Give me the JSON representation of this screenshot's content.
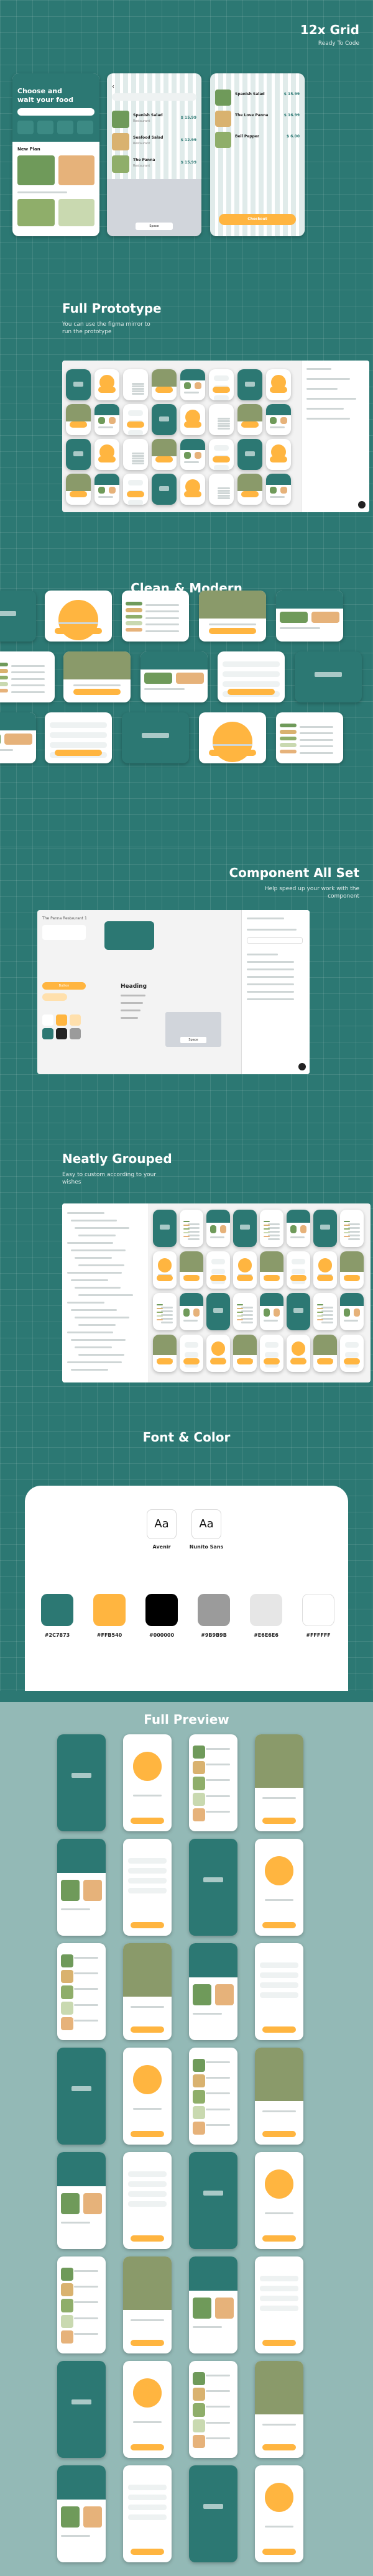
{
  "hero": {
    "title": "12x Grid",
    "subtitle": "Ready To Code",
    "app_heading_line1": "Choose and",
    "app_heading_line2": "wait your food",
    "new_plan_label": "New Plan",
    "menu_items": [
      {
        "name": "Spanish Salad",
        "sub": "Restaurant",
        "price": "$ 15.99"
      },
      {
        "name": "Seafood Salad",
        "sub": "Restaurant",
        "price": "$ 12.99"
      },
      {
        "name": "The Panna",
        "sub": "Restaurant",
        "price": "$ 15.99"
      }
    ],
    "cart_items": [
      {
        "name": "Spanish Salad",
        "price": "$ 15.99"
      },
      {
        "name": "The Love Panna",
        "price": "$ 16.99"
      },
      {
        "name": "Bell Pepper",
        "price": "$ 6.00"
      }
    ],
    "keyboard_space_label": "Space",
    "checkout_label": "Checkout"
  },
  "prototype": {
    "title": "Full Prototype",
    "subtitle_line1": "You can use the figma mirror to",
    "subtitle_line2": "run the prototype"
  },
  "clean": {
    "title": "Clean & Modern"
  },
  "components": {
    "title": "Component All Set",
    "subtitle_line1": "Help speed up your work with the",
    "subtitle_line2": "component",
    "restaurant_label": "The Panna Restaurant 1",
    "heading_label": "Heading",
    "button_label": "Button",
    "space_label": "Space"
  },
  "grouped": {
    "title": "Neatly Grouped",
    "subtitle_line1": "Easy to custom according to your",
    "subtitle_line2": "wishes"
  },
  "font_color": {
    "title": "Font & Color",
    "fonts": [
      {
        "glyph": "Aa",
        "name": "Avenir"
      },
      {
        "glyph": "Aa",
        "name": "Nunito Sans"
      }
    ],
    "colors": [
      {
        "hex": "#2c7873",
        "label": "#2C7873"
      },
      {
        "hex": "#ffb540",
        "label": "#FFB540"
      },
      {
        "hex": "#000000",
        "label": "#000000"
      },
      {
        "hex": "#9b9b9b",
        "label": "#9B9B9B"
      },
      {
        "hex": "#e6e6e6",
        "label": "#E6E6E6"
      },
      {
        "hex": "#ffffff",
        "label": "#FFFFFF"
      }
    ]
  },
  "preview": {
    "title": "Full Preview"
  },
  "colors": {
    "teal": "#2c7873",
    "orange": "#ffb540",
    "preview_bg": "#93b9b6"
  }
}
